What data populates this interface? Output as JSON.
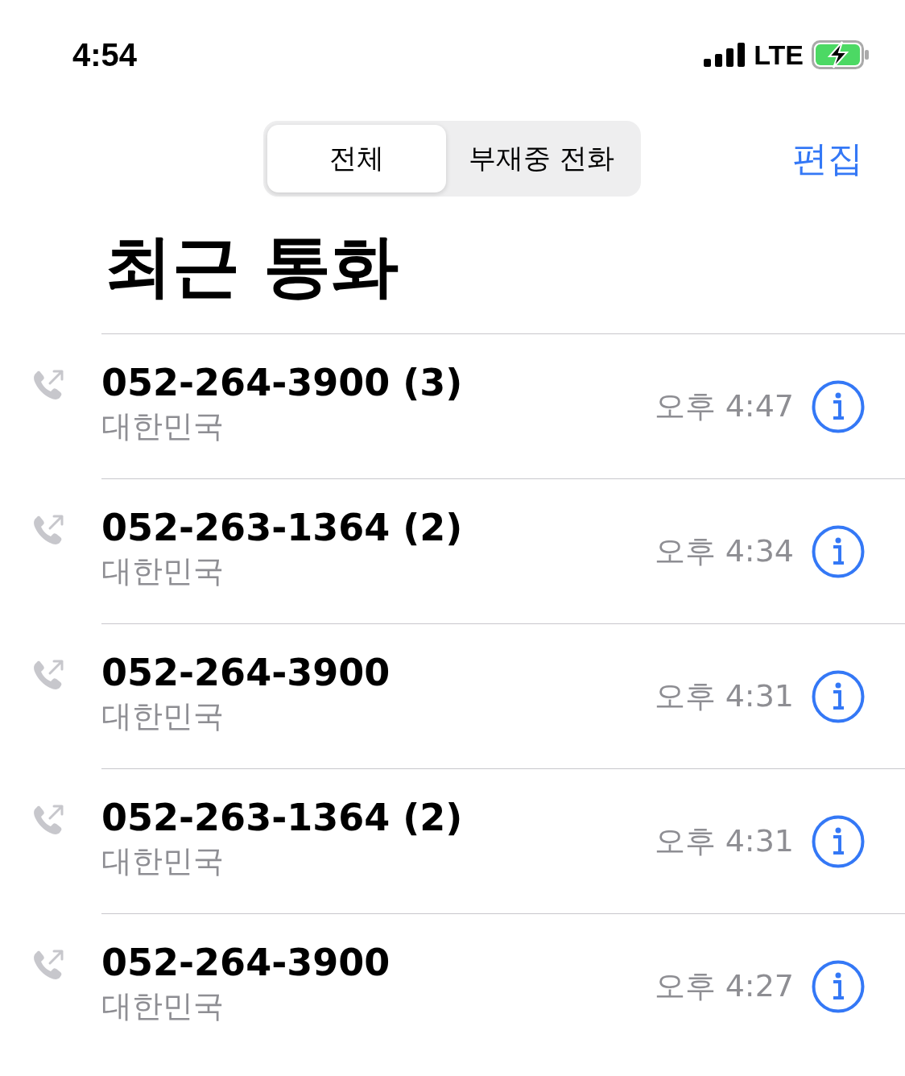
{
  "status_bar": {
    "time": "4:54",
    "network": "LTE"
  },
  "segments": [
    {
      "label": "전체",
      "selected": true
    },
    {
      "label": "부재중 전화",
      "selected": false
    }
  ],
  "edit_button": "편집",
  "title": "최근 통화",
  "calls": [
    {
      "number": "052-264-3900 (3)",
      "location": "대한민국",
      "time": "오후 4:47"
    },
    {
      "number": "052-263-1364 (2)",
      "location": "대한민국",
      "time": "오후 4:34"
    },
    {
      "number": "052-264-3900",
      "location": "대한민국",
      "time": "오후 4:31"
    },
    {
      "number": "052-263-1364 (2)",
      "location": "대한민국",
      "time": "오후 4:31"
    },
    {
      "number": "052-264-3900",
      "location": "대한민국",
      "time": "오후 4:27"
    }
  ]
}
